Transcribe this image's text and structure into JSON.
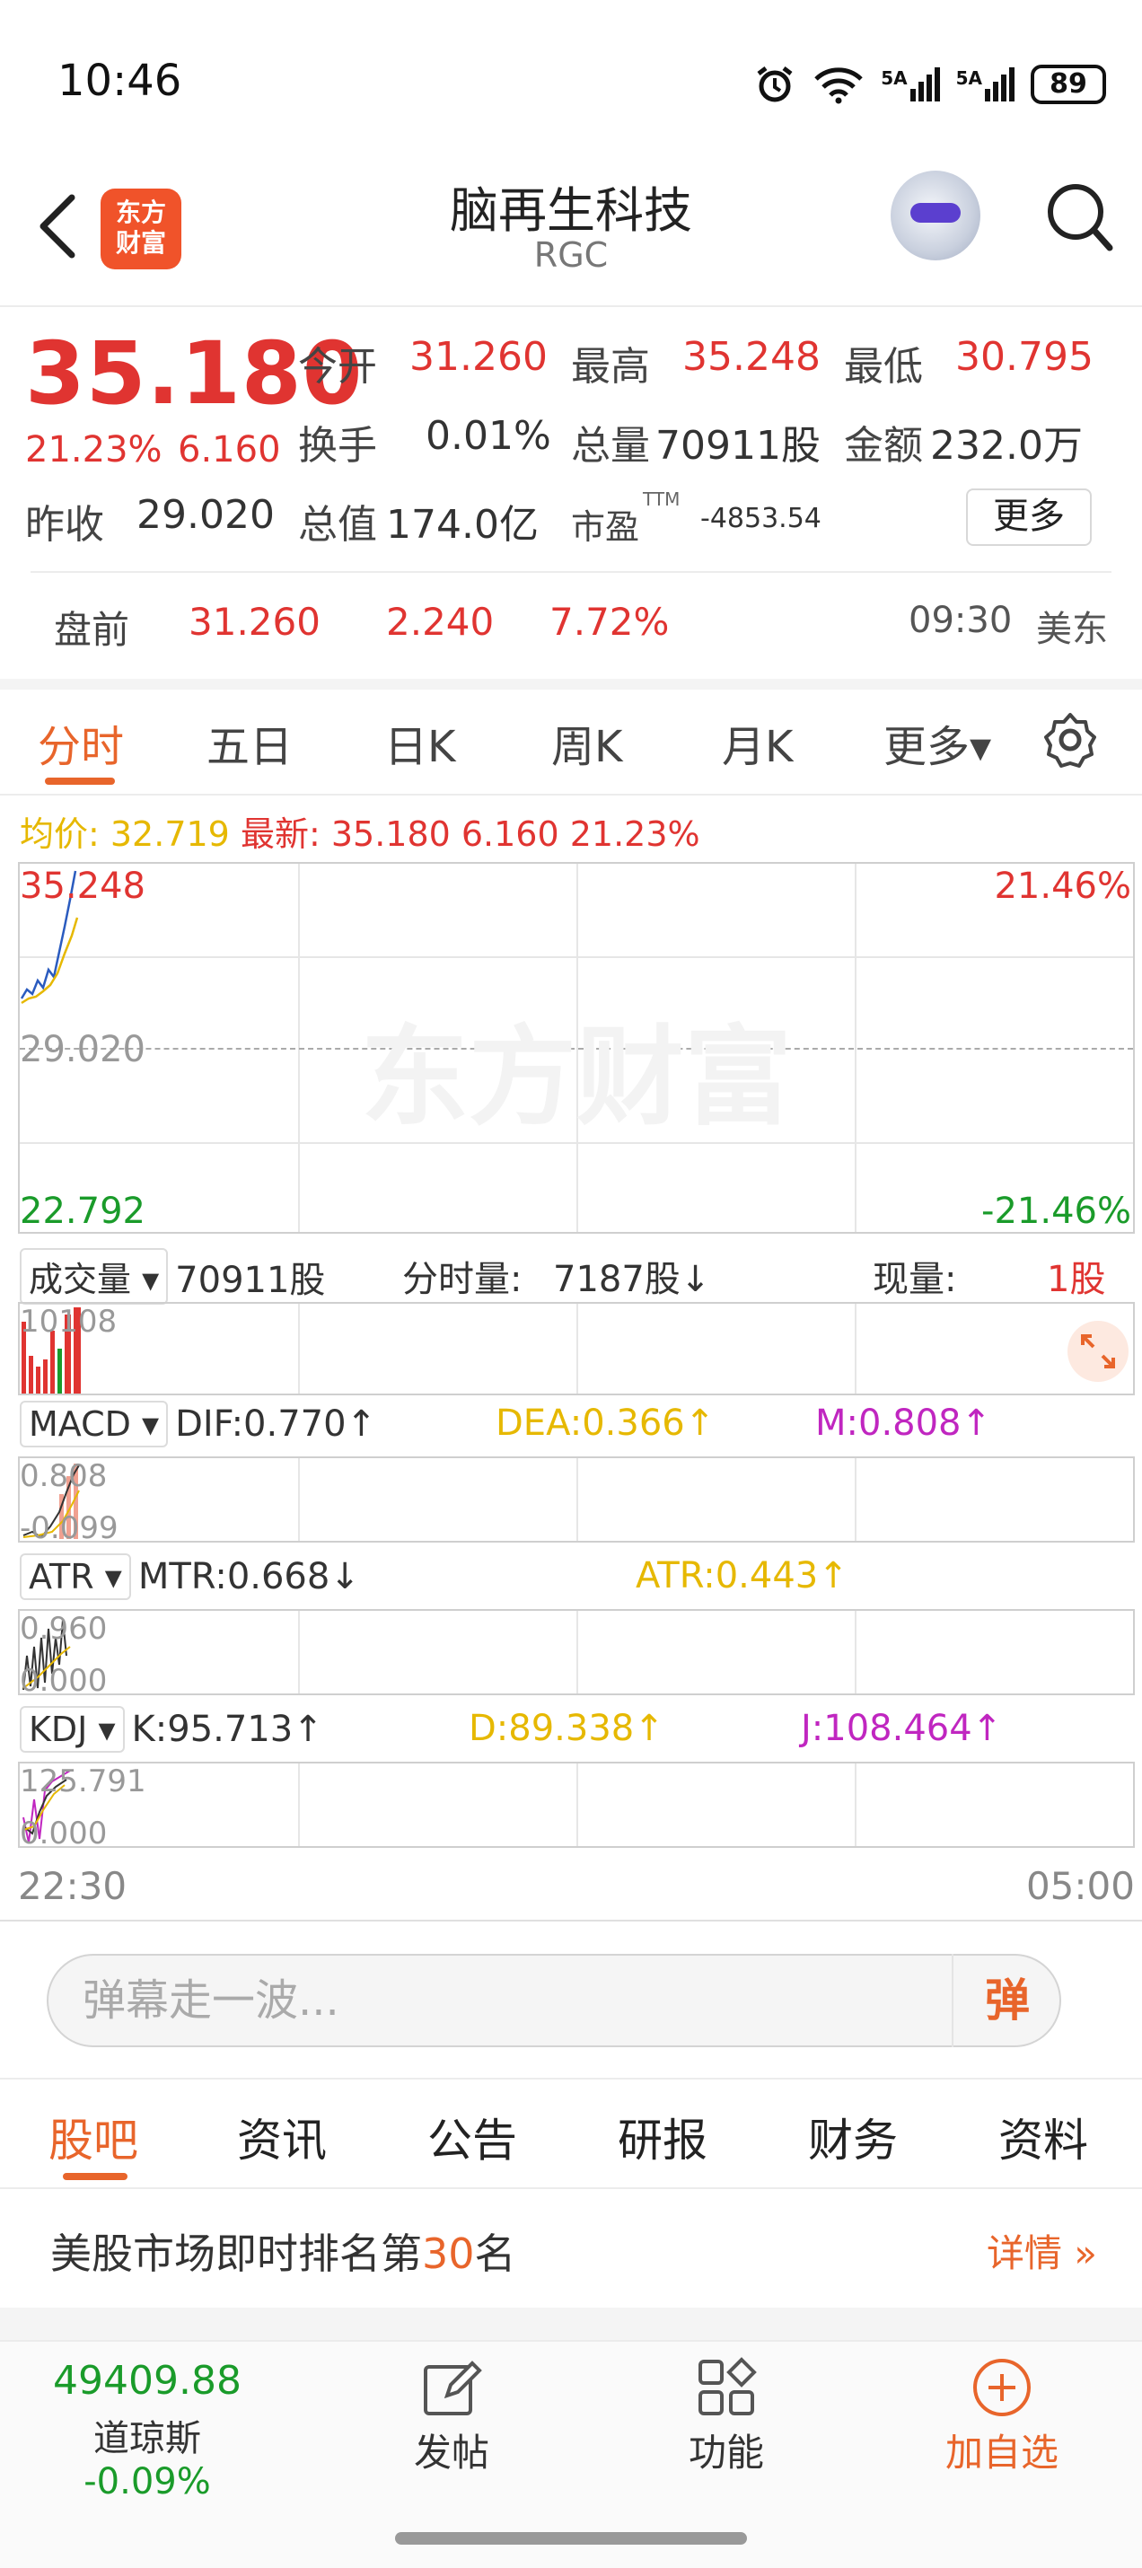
{
  "status_bar": {
    "time": "10:46",
    "battery": "89",
    "signal_1": "5A",
    "signal_2": "5A"
  },
  "header": {
    "stock_name": "脑再生科技",
    "stock_code": "RGC",
    "logo_text_1": "东方",
    "logo_text_2": "财富"
  },
  "quote": {
    "price": "35.180",
    "change_pct": "21.23%",
    "change_amt": "6.160",
    "open_label": "今开",
    "open": "31.260",
    "high_label": "最高",
    "high": "35.248",
    "low_label": "最低",
    "low": "30.795",
    "turnover_label": "换手",
    "turnover": "0.01%",
    "volume_label": "总量",
    "volume": "70911股",
    "amount_label": "金额",
    "amount": "232.0万",
    "prev_close_label": "昨收",
    "prev_close": "29.020",
    "mkt_cap_label": "总值",
    "mkt_cap": "174.0亿",
    "pe_label": "市盈",
    "pe_sup": "TTM",
    "pe": "-4853.54",
    "more_label": "更多"
  },
  "premarket": {
    "label": "盘前",
    "price": "31.260",
    "change": "2.240",
    "pct": "7.72%",
    "time": "09:30",
    "zone": "美东"
  },
  "tabs": [
    "分时",
    "五日",
    "日K",
    "周K",
    "月K",
    "更多▾"
  ],
  "chart": {
    "avg_label": "均价: 32.719",
    "latest_label": "最新: 35.180 6.160 21.23%",
    "y_top": "35.248",
    "y_mid": "29.020",
    "y_bottom": "22.792",
    "pct_top": "21.46%",
    "pct_bottom": "-21.46%",
    "watermark": "东方财富",
    "time_start": "22:30",
    "time_end": "05:00"
  },
  "volume_bar": {
    "selector": "成交量",
    "total": "70911股",
    "period_label": "分时量:",
    "period": "7187股↓",
    "current_label": "现量:",
    "current": "1股",
    "axis_max": "10108"
  },
  "macd": {
    "selector": "MACD",
    "dif": "DIF:0.770↑",
    "dea": "DEA:0.366↑",
    "m": "M:0.808↑",
    "axis_max": "0.808",
    "axis_min": "-0.099"
  },
  "atr": {
    "selector": "ATR",
    "mtr": "MTR:0.668↓",
    "atr": "ATR:0.443↑",
    "axis_max": "0.960",
    "axis_min": "0.000"
  },
  "kdj": {
    "selector": "KDJ",
    "k": "K:95.713↑",
    "d": "D:89.338↑",
    "j": "J:108.464↑",
    "axis_max": "125.791",
    "axis_min": "0.000"
  },
  "danmu": {
    "placeholder": "弹幕走一波...",
    "button": "弹"
  },
  "bottom_tabs": [
    "股吧",
    "资讯",
    "公告",
    "研报",
    "财务",
    "资料"
  ],
  "rank": {
    "prefix": "美股市场即时排名第",
    "rank": "30",
    "suffix": "名",
    "detail": "详情"
  },
  "bottom_nav": {
    "index_value": "49409.88",
    "index_name": "道琼斯",
    "index_change": "-0.09%",
    "post": "发帖",
    "tools": "功能",
    "add_watch": "加自选"
  },
  "colors": {
    "up": "#e03431",
    "down": "#1a9b2a",
    "accent": "#e8652b"
  }
}
